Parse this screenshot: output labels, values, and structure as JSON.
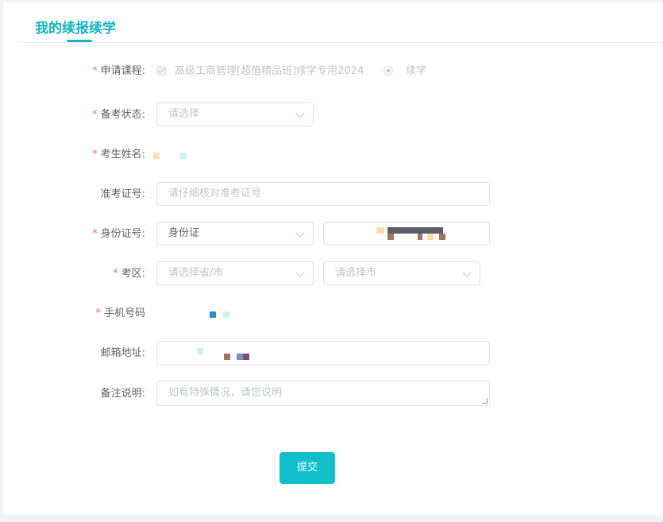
{
  "tab": {
    "title": "我的续报续学"
  },
  "form": {
    "course": {
      "label": "申请课程:",
      "course_name": "高级工商管理[超值精品班]续学专用2024",
      "option": "续学"
    },
    "exam_status": {
      "label": "备考状态:",
      "placeholder": "请选择"
    },
    "name": {
      "label": "考生姓名:"
    },
    "admission_no": {
      "label": "准考证号:",
      "placeholder": "请仔细核对准考证号"
    },
    "id_no": {
      "label": "身份证号:",
      "type_value": "身份证"
    },
    "exam_area": {
      "label": "考区:",
      "province_placeholder": "请选择省/市",
      "city_placeholder": "请选择市"
    },
    "phone": {
      "label": "手机号码"
    },
    "email": {
      "label": "邮箱地址:"
    },
    "remark": {
      "label": "备注说明:",
      "placeholder": "如有特殊情况，请您说明"
    },
    "required_mark": "*"
  },
  "submit_label": "提交",
  "colors": {
    "accent": "#11b3c3",
    "required": "#f56c6c"
  }
}
